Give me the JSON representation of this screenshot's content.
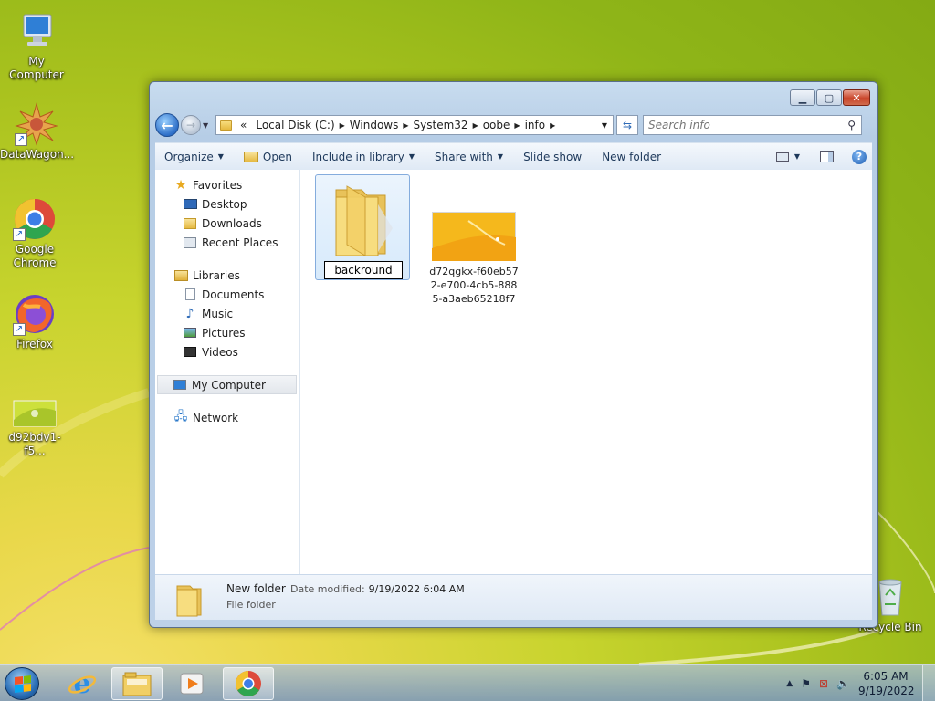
{
  "desktop": {
    "icons": [
      {
        "label": "My Computer",
        "icon": "computer-icon"
      },
      {
        "label": "DataWagon...",
        "icon": "datawagon-icon"
      },
      {
        "label": "Google Chrome",
        "icon": "chrome-icon"
      },
      {
        "label": "Firefox",
        "icon": "firefox-icon"
      },
      {
        "label": "d92bdv1-f5...",
        "icon": "image-file-icon"
      },
      {
        "label": "Recycle Bin",
        "icon": "recycle-bin-icon"
      }
    ]
  },
  "window": {
    "address": {
      "overflow": "«",
      "segments": [
        "Local Disk (C:)",
        "Windows",
        "System32",
        "oobe",
        "info"
      ]
    },
    "search_placeholder": "Search info",
    "toolbar": {
      "organize": "Organize",
      "open": "Open",
      "include_in_library": "Include in library",
      "share_with": "Share with",
      "slide_show": "Slide show",
      "new_folder": "New folder"
    },
    "nav": {
      "favorites": "Favorites",
      "desktop": "Desktop",
      "downloads": "Downloads",
      "recent_places": "Recent Places",
      "libraries": "Libraries",
      "documents": "Documents",
      "music": "Music",
      "pictures": "Pictures",
      "videos": "Videos",
      "my_computer": "My Computer",
      "network": "Network"
    },
    "content": {
      "rename_value": "backround",
      "file_name_lines": [
        "d72qgkx-f60eb57",
        "2-e700-4cb5-888",
        "5-a3aeb65218f7"
      ]
    },
    "details": {
      "name": "New folder",
      "modified_label": "Date modified:",
      "modified_value": "9/19/2022 6:04 AM",
      "type": "File folder"
    }
  },
  "taskbar": {
    "time": "6:05 AM",
    "date": "9/19/2022",
    "pinned": [
      "internet-explorer-icon",
      "file-explorer-icon",
      "media-player-icon",
      "chrome-icon"
    ]
  }
}
